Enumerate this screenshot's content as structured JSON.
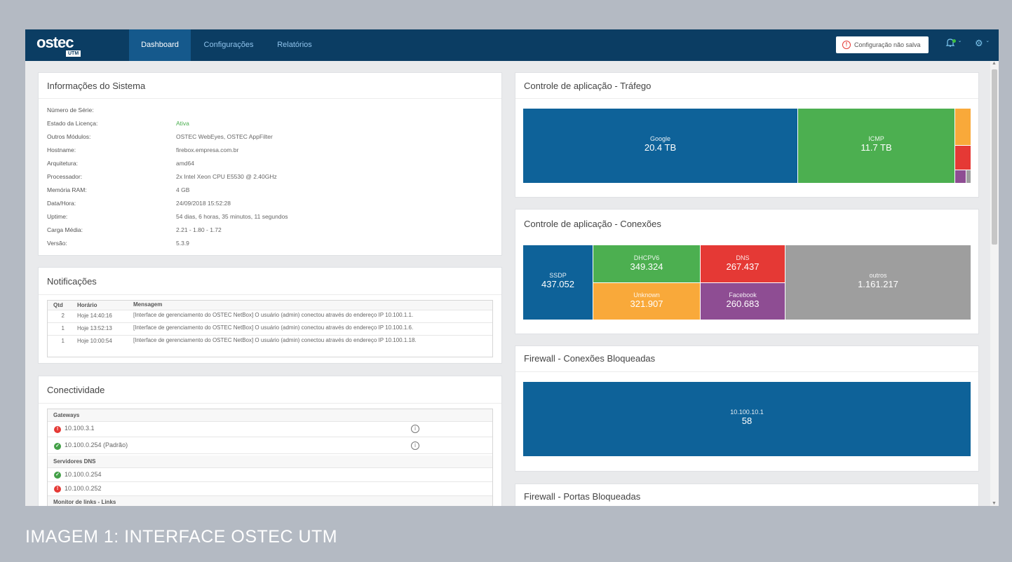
{
  "app": {
    "logo": "ostec",
    "logo_badge": "UTM",
    "tabs": [
      {
        "label": "Dashboard",
        "active": true
      },
      {
        "label": "Configurações"
      },
      {
        "label": "Relatórios"
      }
    ],
    "unsaved_label": "Configuração não salva"
  },
  "system_info": {
    "title": "Informações do Sistema",
    "rows": [
      {
        "label": "Número de Série:",
        "value": ""
      },
      {
        "label": "Estado da Licença:",
        "value": "Ativa"
      },
      {
        "label": "Outros Módulos:",
        "value": "OSTEC WebEyes, OSTEC AppFilter"
      },
      {
        "label": "Hostname:",
        "value": "firebox.empresa.com.br"
      },
      {
        "label": "Arquitetura:",
        "value": "amd64"
      },
      {
        "label": "Processador:",
        "value": "2x Intel Xeon CPU E5530 @ 2.40GHz"
      },
      {
        "label": "Memória RAM:",
        "value": "4 GB"
      },
      {
        "label": "Data/Hora:",
        "value": "24/09/2018 15:52:28"
      },
      {
        "label": "Uptime:",
        "value": "54 dias, 6 horas, 35 minutos, 11 segundos"
      },
      {
        "label": "Carga Média:",
        "value": "2.21 - 1.80 - 1.72"
      },
      {
        "label": "Versão:",
        "value": "5.3.9"
      }
    ]
  },
  "notifications": {
    "title": "Notificações",
    "headers": [
      "Qtd",
      "Horário",
      "Mensagem"
    ],
    "rows": [
      {
        "qtd": "2",
        "time": "Hoje 14:40:16",
        "msg": "[Interface de gerenciamento do OSTEC NetBox] O usuário (admin) conectou através do endereço IP 10.100.1.1."
      },
      {
        "qtd": "1",
        "time": "Hoje 13:52:13",
        "msg": "[Interface de gerenciamento do OSTEC NetBox] O usuário (admin) conectou através do endereço IP 10.100.1.6."
      },
      {
        "qtd": "1",
        "time": "Hoje 10:00:54",
        "msg": "[Interface de gerenciamento do OSTEC NetBox] O usuário (admin) conectou através do endereço IP 10.100.1.18."
      }
    ]
  },
  "connectivity": {
    "title": "Conectividade",
    "gateways_label": "Gateways",
    "gateways": [
      {
        "ip": "10.100.3.1",
        "status": "error"
      },
      {
        "ip": "10.100.0.254 (Padrão)",
        "status": "ok"
      }
    ],
    "dns_label": "Servidores DNS",
    "dns": [
      {
        "ip": "10.100.0.254",
        "status": "ok"
      },
      {
        "ip": "10.100.0.252",
        "status": "error"
      }
    ],
    "links_label": "Monitor de links - Links"
  },
  "charts": {
    "traffic": {
      "title": "Controle de aplicação - Tráfego",
      "cells": [
        {
          "label": "Google",
          "value": "20.4 TB",
          "color": "#0e6299"
        },
        {
          "label": "ICMP",
          "value": "11.7 TB",
          "color": "#4caf50"
        }
      ]
    },
    "connections": {
      "title": "Controle de aplicação - Conexões",
      "cells": [
        {
          "label": "SSDP",
          "value": "437.052",
          "color": "#0e6299"
        },
        {
          "label": "DHCPV6",
          "value": "349.324",
          "color": "#4caf50"
        },
        {
          "label": "DNS",
          "value": "267.437",
          "color": "#e53935"
        },
        {
          "label": "outros",
          "value": "1.161.217",
          "color": "#9e9e9e"
        },
        {
          "label": "Unknown",
          "value": "321.907",
          "color": "#f9a93a"
        },
        {
          "label": "Facebook",
          "value": "260.683",
          "color": "#8e4d93"
        }
      ]
    },
    "fw_connections": {
      "title": "Firewall - Conexões Bloqueadas",
      "cells": [
        {
          "label": "10.100.10.1",
          "value": "58",
          "color": "#0e6299"
        }
      ]
    },
    "fw_ports": {
      "title": "Firewall - Portas Bloqueadas"
    }
  },
  "caption": "IMAGEM 1: INTERFACE OSTEC UTM",
  "colors": {
    "nav_bg": "#0b3d63",
    "nav_active": "#15598c",
    "page_bg": "#b4bac3"
  }
}
